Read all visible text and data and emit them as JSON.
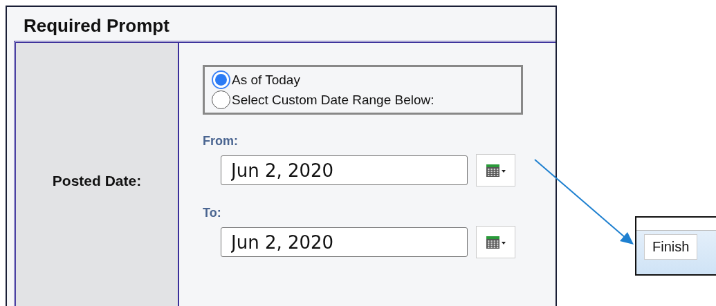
{
  "panel": {
    "title": "Required Prompt"
  },
  "prompt": {
    "label": "Posted Date:",
    "options": [
      {
        "label": "As of Today",
        "selected": true
      },
      {
        "label": "Select Custom Date Range Below:",
        "selected": false
      }
    ],
    "dates": [
      {
        "label": "From:",
        "value": "Jun 2, 2020"
      },
      {
        "label": "To:",
        "value": "Jun 2, 2020"
      }
    ]
  },
  "inset": {
    "button": "Finish"
  }
}
